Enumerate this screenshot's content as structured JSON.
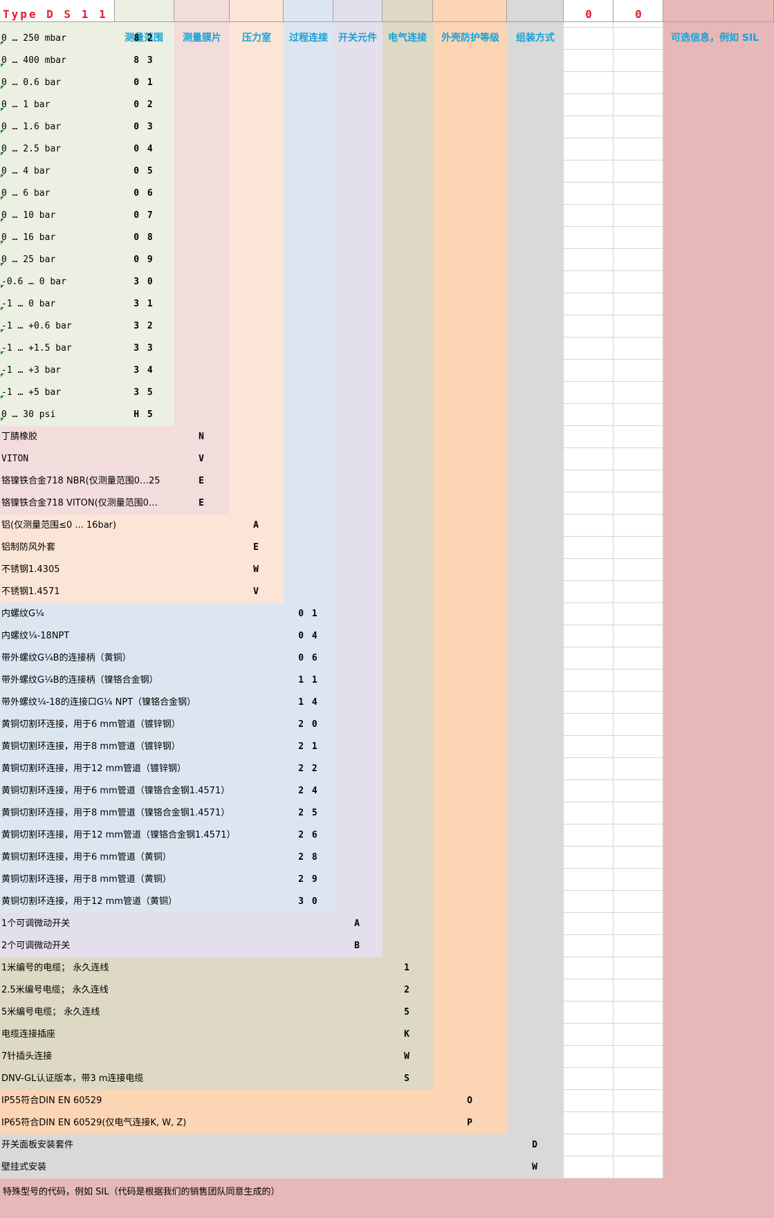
{
  "title": "Type  D S 1 1",
  "header_values": [
    "0",
    "0"
  ],
  "colors": {
    "range": "#ebf0e3",
    "diaphragm": "#f2dcdc",
    "chamber": "#fbe5d6",
    "connection": "#dce6f1",
    "switch": "#e4dfec",
    "electrical": "#ddd9c4",
    "protection": "#fcd5b4",
    "mounting": "#d9d9d9",
    "optional": "#e6b8b7",
    "header_text": "#17a2d8",
    "title_text": "#e8192c"
  },
  "headers": [
    "测量范围",
    "测量膜片",
    "压力室",
    "过程连接",
    "开关元件",
    "电气连接",
    "外壳防护等级",
    "组装方式",
    "可选信息，例如 SIL"
  ],
  "rows": [
    {
      "label": "0 … 250 mbar",
      "code": "8 2"
    },
    {
      "label": "0 … 400 mbar",
      "code": "8 3"
    },
    {
      "label": "0 … 0.6 bar",
      "code": "0 1"
    },
    {
      "label": "0 … 1 bar",
      "code": "0 2"
    },
    {
      "label": "0 … 1.6 bar",
      "code": "0 3"
    },
    {
      "label": "0 … 2.5 bar",
      "code": "0 4"
    },
    {
      "label": "0 … 4 bar",
      "code": "0 5"
    },
    {
      "label": "0 … 6 bar",
      "code": "0 6"
    },
    {
      "label": "0 … 10 bar",
      "code": "0 7"
    },
    {
      "label": "0 … 16 bar",
      "code": "0 8"
    },
    {
      "label": "0 … 25 bar",
      "code": "0 9"
    },
    {
      "label": "-0.6 … 0 bar",
      "code": "3 0"
    },
    {
      "label": "-1 … 0 bar",
      "code": "3 1"
    },
    {
      "label": "-1 … +0.6 bar",
      "code": "3 2"
    },
    {
      "label": "-1 … +1.5 bar",
      "code": "3 3"
    },
    {
      "label": "-1 … +3 bar",
      "code": "3 4"
    },
    {
      "label": "-1 … +5 bar",
      "code": "3 5"
    },
    {
      "label": " 0 … 30 psi",
      "code": "H 5"
    },
    {
      "label": "丁腈橡胶",
      "code": "N"
    },
    {
      "label": "VITON",
      "code": "V"
    },
    {
      "label": "铬镍铁合金718 NBR(仅测量范围0…25",
      "code": "E"
    },
    {
      "label": "铬镍铁合金718 VITON(仅测量范围0…",
      "code": "E"
    },
    {
      "label": "铝(仅测量范围≤0 ... 16bar)",
      "code": "A"
    },
    {
      "label": "铝制防风外套",
      "code": "E"
    },
    {
      "label": "不锈钢1.4305",
      "code": "W"
    },
    {
      "label": "不锈钢1.4571",
      "code": "V"
    },
    {
      "label": "内螺纹G¼",
      "code": "0 1"
    },
    {
      "label": "内螺纹¼-18NPT",
      "code": "0 4"
    },
    {
      "label": "带外螺纹G¼B的连接柄（黄铜）",
      "code": "0 6"
    },
    {
      "label": "带外螺纹G¼B的连接柄（镍铬合金钢）",
      "code": "1 1"
    },
    {
      "label": "带外螺纹¼-18的连接口G¼ NPT（镍铬合金钢）",
      "code": "1 4"
    },
    {
      "label": "黄铜切割环连接，用于6 mm管道（镀锌钢）",
      "code": "2 0"
    },
    {
      "label": "黄铜切割环连接，用于8 mm管道（镀锌钢）",
      "code": "2 1"
    },
    {
      "label": "黄铜切割环连接，用于12 mm管道（镀锌钢）",
      "code": "2 2"
    },
    {
      "label": "黄铜切割环连接，用于6 mm管道（镍铬合金钢1.4571）",
      "code": "2 4"
    },
    {
      "label": "黄铜切割环连接，用于8 mm管道（镍铬合金钢1.4571）",
      "code": "2 5"
    },
    {
      "label": "黄铜切割环连接，用于12 mm管道（镍铬合金钢1.4571）",
      "code": "2 6"
    },
    {
      "label": "黄铜切割环连接，用于6 mm管道（黄铜）",
      "code": "2 8"
    },
    {
      "label": "黄铜切割环连接，用于8 mm管道（黄铜）",
      "code": "2 9"
    },
    {
      "label": "黄铜切割环连接，用于12 mm管道（黄铜）",
      "code": "3 0"
    },
    {
      "label": "1个可调微动开关",
      "code": "A"
    },
    {
      "label": "2个可调微动开关",
      "code": "B"
    },
    {
      "label": "1米编号的电缆； 永久连线",
      "code": "1"
    },
    {
      "label": "2.5米编号电缆； 永久连线",
      "code": "2"
    },
    {
      "label": "5米编号电缆； 永久连线",
      "code": "5"
    },
    {
      "label": "电缆连接插座",
      "code": "K"
    },
    {
      "label": "7针插头连接",
      "code": "W"
    },
    {
      "label": "DNV-GL认证版本，带3 m连接电缆",
      "code": "S"
    },
    {
      "label": "IP55符合DIN EN 60529",
      "code": "O"
    },
    {
      "label": "IP65符合DIN EN 60529(仅电气连接K, W, Z)",
      "code": "P"
    },
    {
      "label": "开关面板安装套件",
      "code": "D"
    },
    {
      "label": "壁挂式安装",
      "code": "W"
    }
  ],
  "footer": "特殊型号的代码，例如 SIL（代码是根据我们的销售团队同意生成的）"
}
